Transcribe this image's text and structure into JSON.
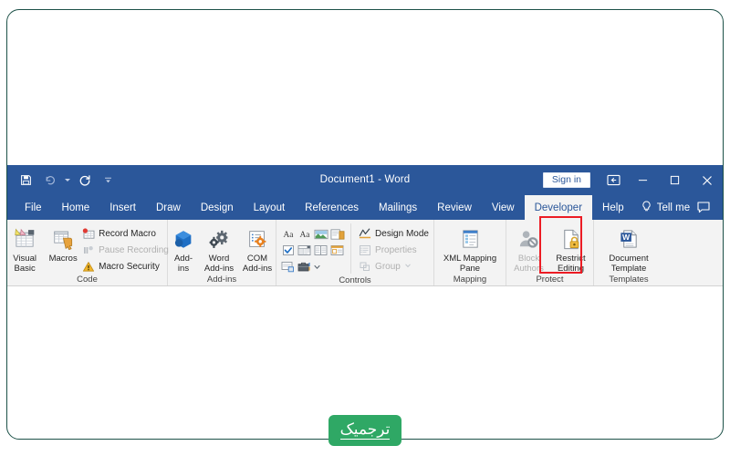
{
  "frame": {
    "border_color": "#1d5148"
  },
  "window": {
    "title": "Document1  -  Word",
    "title_bar_color": "#2b579a",
    "quick_access": [
      {
        "name": "save-icon",
        "label": "Save"
      },
      {
        "name": "undo-icon",
        "label": "Undo"
      },
      {
        "name": "redo-icon",
        "label": "Redo"
      },
      {
        "name": "customize-quick-access-toolbar-icon",
        "label": "Customize Quick Access Toolbar"
      }
    ],
    "sign_in_label": "Sign in",
    "ribbon_display_options_label": "Ribbon Display Options",
    "minimize_label": "Minimize",
    "maximize_label": "Maximize",
    "close_label": "Close"
  },
  "tabs": [
    {
      "label": "File",
      "active": false
    },
    {
      "label": "Home",
      "active": false
    },
    {
      "label": "Insert",
      "active": false
    },
    {
      "label": "Draw",
      "active": false
    },
    {
      "label": "Design",
      "active": false
    },
    {
      "label": "Layout",
      "active": false
    },
    {
      "label": "References",
      "active": false
    },
    {
      "label": "Mailings",
      "active": false
    },
    {
      "label": "Review",
      "active": false
    },
    {
      "label": "View",
      "active": false
    },
    {
      "label": "Developer",
      "active": true
    },
    {
      "label": "Help",
      "active": false
    }
  ],
  "tell_me": {
    "label": "Tell me",
    "icon": "lightbulb-icon"
  },
  "comments": {
    "label": "Comments",
    "icon": "comment-icon"
  },
  "ribbon": {
    "groups": [
      {
        "name": "code",
        "label": "Code",
        "big_buttons": [
          {
            "label_line1": "Visual",
            "label_line2": "Basic",
            "icon": "visual-basic-icon",
            "disabled": false
          },
          {
            "label_line1": "Macros",
            "label_line2": "",
            "icon": "macros-icon",
            "disabled": false
          }
        ],
        "small_buttons": [
          {
            "label": "Record Macro",
            "icon": "record-macro-icon",
            "disabled": false
          },
          {
            "label": "Pause Recording",
            "icon": "pause-recording-icon",
            "disabled": true
          },
          {
            "label": "Macro Security",
            "icon": "macro-security-icon",
            "disabled": false
          }
        ]
      },
      {
        "name": "add-ins",
        "label": "Add-ins",
        "big_buttons": [
          {
            "label_line1": "Add-",
            "label_line2": "ins",
            "icon": "add-ins-icon",
            "disabled": false
          },
          {
            "label_line1": "Word",
            "label_line2": "Add-ins",
            "icon": "word-add-ins-icon",
            "disabled": false
          },
          {
            "label_line1": "COM",
            "label_line2": "Add-ins",
            "icon": "com-add-ins-icon",
            "disabled": false
          }
        ]
      },
      {
        "name": "controls",
        "label": "Controls",
        "grid_icons": [
          "rich-text-content-control-icon",
          "plain-text-content-control-icon",
          "picture-content-control-icon",
          "building-block-gallery-icon",
          "check-box-content-control-icon",
          "combo-box-content-control-icon",
          "drop-down-list-content-control-icon",
          "date-picker-content-control-icon",
          "repeating-section-content-control-icon",
          "legacy-tools-icon"
        ],
        "side_buttons": [
          {
            "label": "Design Mode",
            "icon": "design-mode-icon",
            "disabled": false
          },
          {
            "label": "Properties",
            "icon": "properties-icon",
            "disabled": true
          },
          {
            "label": "Group",
            "icon": "group-icon",
            "disabled": true,
            "has_caret": true
          }
        ]
      },
      {
        "name": "mapping",
        "label": "Mapping",
        "big_buttons": [
          {
            "label_line1": "XML Mapping",
            "label_line2": "Pane",
            "icon": "xml-mapping-pane-icon",
            "disabled": false
          }
        ]
      },
      {
        "name": "protect",
        "label": "Protect",
        "big_buttons": [
          {
            "label_line1": "Block",
            "label_line2": "Authors",
            "icon": "block-authors-icon",
            "disabled": true,
            "has_caret": true
          },
          {
            "label_line1": "Restrict",
            "label_line2": "Editing",
            "icon": "restrict-editing-icon",
            "disabled": false,
            "highlighted": true
          }
        ]
      },
      {
        "name": "templates",
        "label": "Templates",
        "big_buttons": [
          {
            "label_line1": "Document",
            "label_line2": "Template",
            "icon": "document-template-icon",
            "disabled": false
          }
        ]
      }
    ]
  },
  "highlight": {
    "color": "#ec1c24",
    "target": "Restrict Editing"
  },
  "logo": {
    "text": "ترجمیک",
    "background": "#2fa865",
    "text_color": "#ffffff"
  }
}
